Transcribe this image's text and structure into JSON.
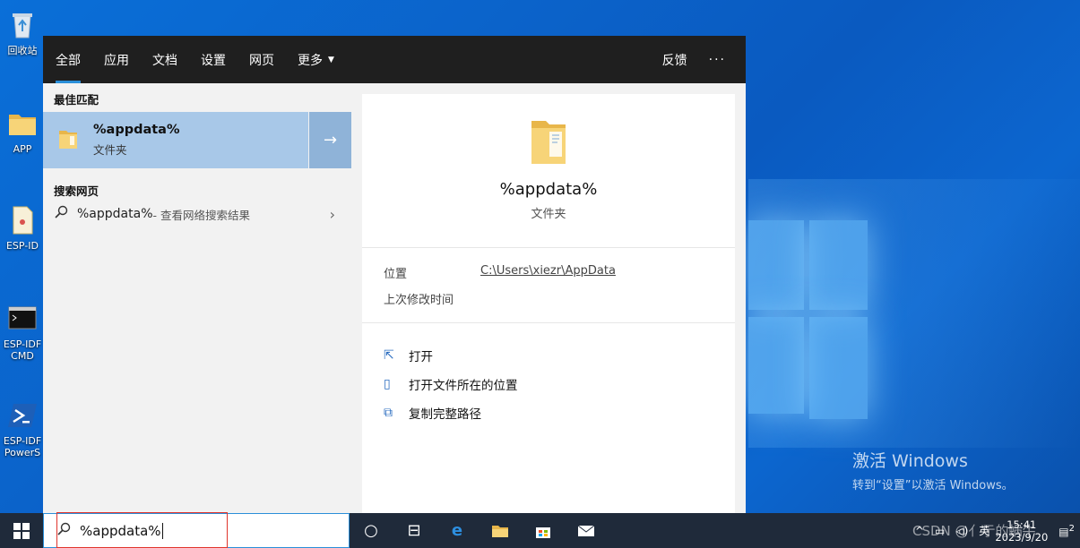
{
  "desktop": {
    "icons": [
      {
        "label": "回收站",
        "icon": "recycle-bin-icon"
      },
      {
        "label": "APP",
        "icon": "folder-icon"
      },
      {
        "label": "ESP-ID",
        "icon": "document-icon"
      },
      {
        "label": "ESP-IDF CMD",
        "icon": "cmd-icon"
      },
      {
        "label": "ESP-IDF PowerS",
        "icon": "powershell-icon"
      }
    ],
    "activate_title": "激活 Windows",
    "activate_sub": "转到“设置”以激活 Windows。"
  },
  "search_panel": {
    "tabs": [
      "全部",
      "应用",
      "文档",
      "设置",
      "网页",
      "更多"
    ],
    "feedback": "反馈",
    "more_options": "···",
    "best_match_title": "最佳匹配",
    "best_match": {
      "name": "%appdata%",
      "type": "文件夹"
    },
    "web_search_title": "搜索网页",
    "web_item": {
      "query": "%appdata%",
      "hint": " - 查看网络搜索结果"
    },
    "detail": {
      "name": "%appdata%",
      "type": "文件夹",
      "location_label": "位置",
      "location_value": "C:\\Users\\xiezr\\AppData",
      "modified_label": "上次修改时间",
      "actions": [
        "打开",
        "打开文件所在的位置",
        "复制完整路径"
      ]
    }
  },
  "taskbar": {
    "search_value": "%appdata%",
    "ime": "英",
    "time": "15:41",
    "date": "2023/9/20",
    "watermark": "CSDN @亻亍的蜗牛",
    "notifications": "2"
  }
}
